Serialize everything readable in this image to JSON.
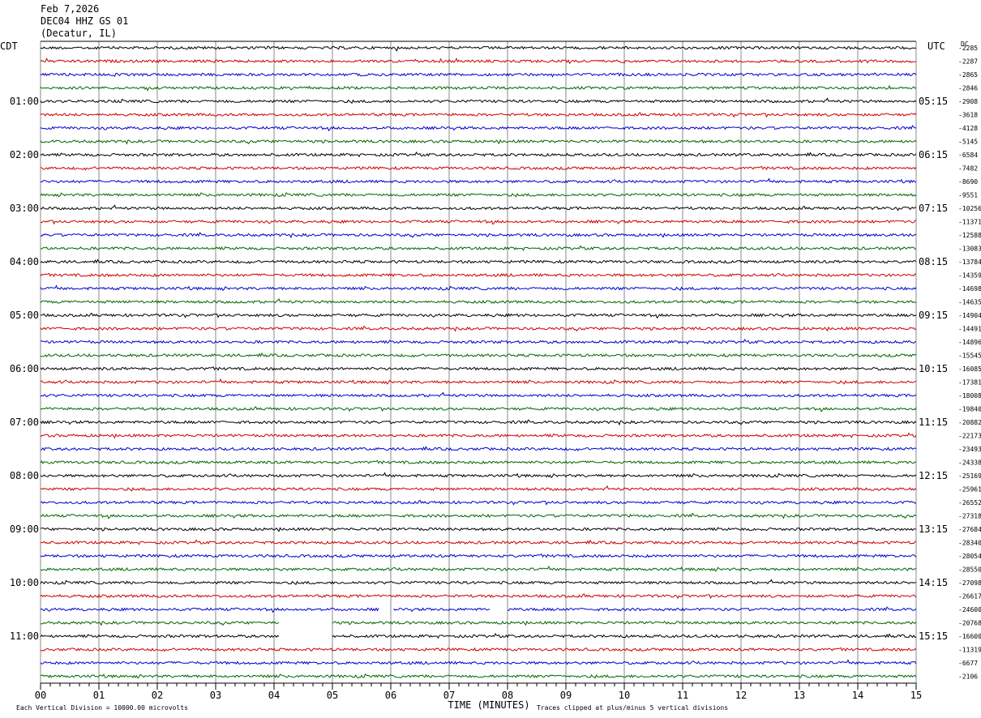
{
  "header": {
    "date": "Feb 7,2026",
    "station": "DEC04 HHZ GS 01",
    "location": "(Decatur, IL)"
  },
  "chart_data": {
    "type": "line",
    "title": "Feb 7,2026",
    "left_tz": "CDT",
    "right_tz": "UTC",
    "right_corner_label": "DC",
    "xlabel": "TIME (MINUTES)",
    "xlim": [
      0,
      15
    ],
    "x_ticks": [
      "00",
      "01",
      "02",
      "03",
      "04",
      "05",
      "06",
      "07",
      "08",
      "09",
      "10",
      "11",
      "12",
      "13",
      "14",
      "15"
    ],
    "line_minutes": 15,
    "line_count": 48,
    "line_colors": [
      "#000000",
      "#cc0000",
      "#0000cc",
      "#006600"
    ],
    "left_hour_labels": [
      "01:00",
      "02:00",
      "03:00",
      "04:00",
      "05:00",
      "06:00",
      "07:00",
      "08:00",
      "09:00",
      "10:00",
      "11:00"
    ],
    "right_hour_labels": [
      "05:15",
      "06:15",
      "07:15",
      "08:15",
      "09:15",
      "10:15",
      "11:15",
      "12:15",
      "13:15",
      "14:15",
      "15:15"
    ],
    "offsets": [
      "-2285",
      "-2287",
      "-2865",
      "-2846",
      "-2908",
      "-3618",
      "-4128",
      "-5145",
      "-6584",
      "-7482",
      "-8690",
      "-9551",
      "-10256",
      "-11371",
      "-12588",
      "-13083",
      "-13784",
      "-14359",
      "-14698",
      "-14635",
      "-14904",
      "-14491",
      "-14896",
      "-15545",
      "-16085",
      "-17381",
      "-18008",
      "-19840",
      "-20882",
      "-22173",
      "-23493",
      "-24338",
      "-25169",
      "-25961",
      "-26552",
      "-27318",
      "-27684",
      "-28340",
      "-28054",
      "-28550",
      "-27098",
      "-26617",
      "-24600",
      "-20768",
      "-16600",
      "-11319",
      "-6677",
      "-2106"
    ],
    "gaps": [
      {
        "line": 42,
        "from_min": 5.8,
        "to_min": 6.05
      },
      {
        "line": 42,
        "from_min": 7.7,
        "to_min": 8.0
      },
      {
        "line": 43,
        "from_min": 4.1,
        "to_min": 5.0
      },
      {
        "line": 44,
        "from_min": 4.1,
        "to_min": 5.0
      }
    ],
    "footer_left": "Each Vertical Division = 10000.00 microvolts",
    "footer_right": "Traces clipped at plus/minus 5 vertical divisions"
  }
}
